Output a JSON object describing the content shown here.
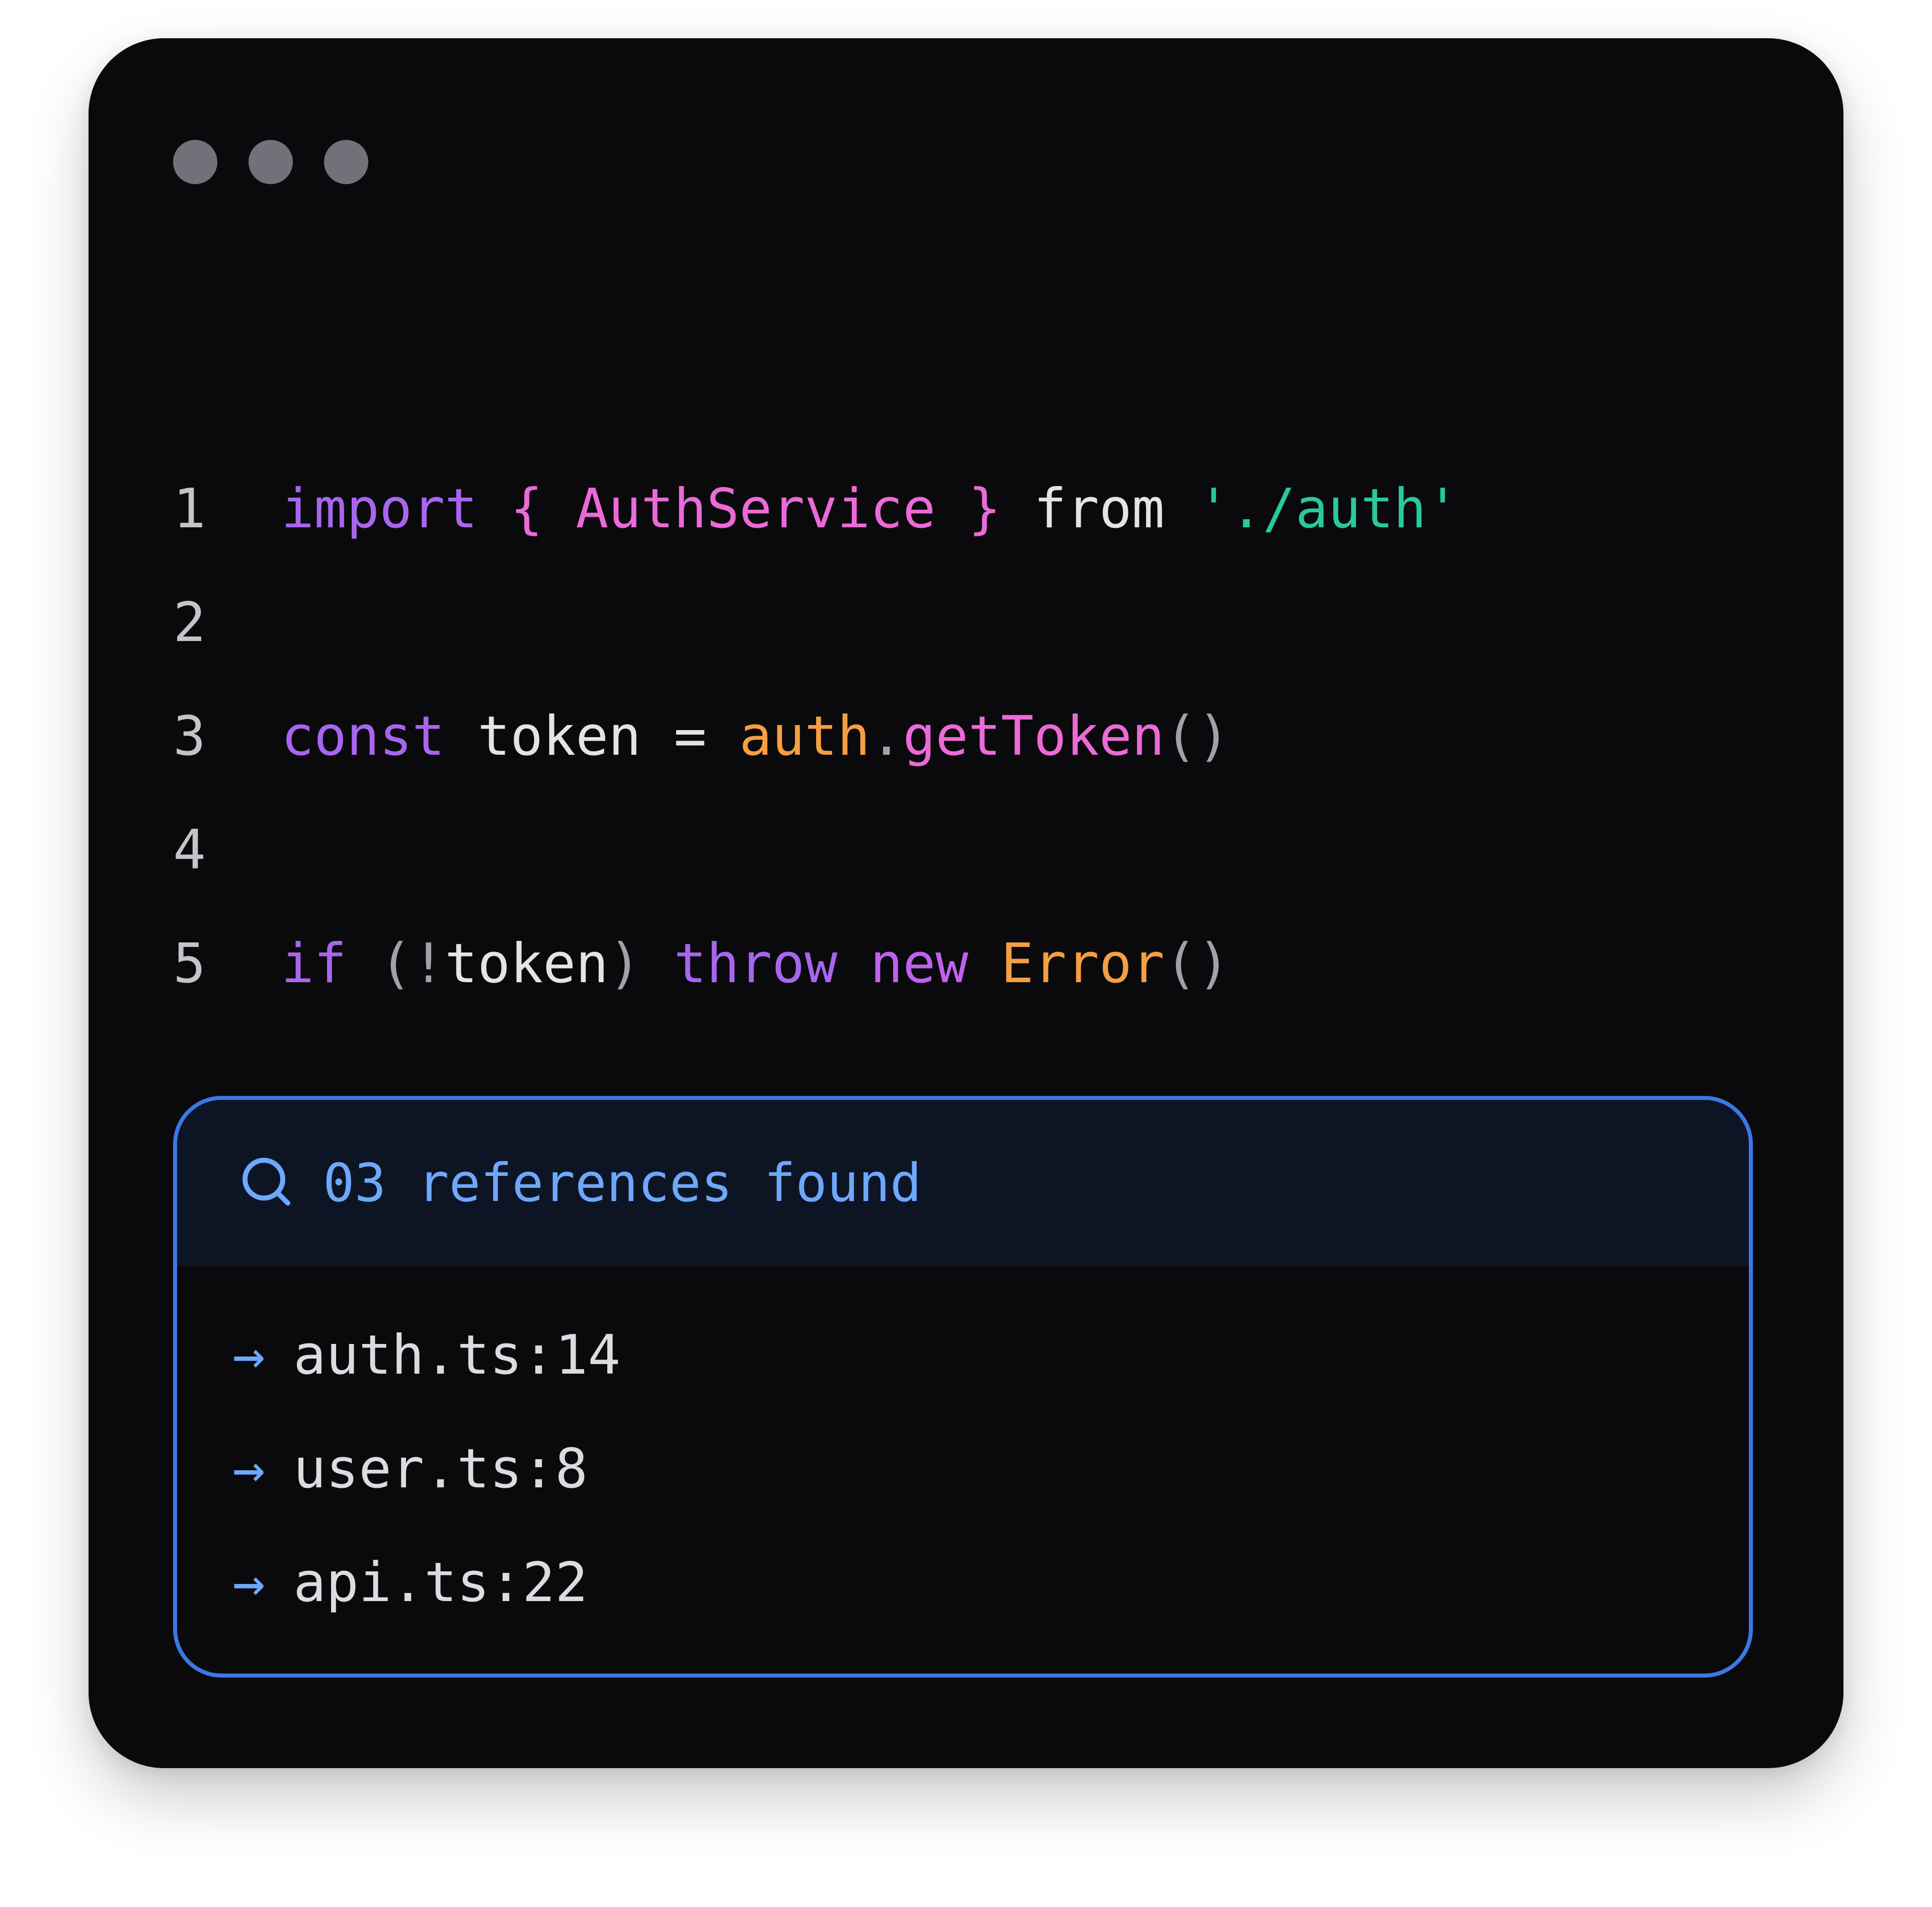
{
  "window": {
    "controls": [
      "dot",
      "dot",
      "dot"
    ]
  },
  "code": {
    "lines": [
      {
        "number": "1",
        "tokens": [
          {
            "text": "import",
            "role": "keyword"
          },
          {
            "text": " ",
            "role": "space"
          },
          {
            "text": "{",
            "role": "punct-pink"
          },
          {
            "text": " ",
            "role": "space"
          },
          {
            "text": "AuthService",
            "role": "ident-pink"
          },
          {
            "text": " ",
            "role": "space"
          },
          {
            "text": "}",
            "role": "punct-pink"
          },
          {
            "text": " ",
            "role": "space"
          },
          {
            "text": "from",
            "role": "plain"
          },
          {
            "text": " ",
            "role": "space"
          },
          {
            "text": "'./auth'",
            "role": "string"
          }
        ]
      },
      {
        "number": "2",
        "tokens": []
      },
      {
        "number": "3",
        "tokens": [
          {
            "text": "const",
            "role": "keyword"
          },
          {
            "text": " ",
            "role": "space"
          },
          {
            "text": "token",
            "role": "plain"
          },
          {
            "text": " = ",
            "role": "plain"
          },
          {
            "text": "auth",
            "role": "orange"
          },
          {
            "text": ".",
            "role": "dim"
          },
          {
            "text": "getToken",
            "role": "ident-pink"
          },
          {
            "text": "()",
            "role": "dim"
          }
        ]
      },
      {
        "number": "4",
        "tokens": []
      },
      {
        "number": "5",
        "tokens": [
          {
            "text": "if",
            "role": "keyword"
          },
          {
            "text": " ",
            "role": "space"
          },
          {
            "text": "(!",
            "role": "dim"
          },
          {
            "text": "token",
            "role": "plain"
          },
          {
            "text": ")",
            "role": "dim"
          },
          {
            "text": " ",
            "role": "space"
          },
          {
            "text": "throw",
            "role": "keyword"
          },
          {
            "text": " ",
            "role": "space"
          },
          {
            "text": "new",
            "role": "keyword2"
          },
          {
            "text": " ",
            "role": "space"
          },
          {
            "text": "Error",
            "role": "orange"
          },
          {
            "text": "()",
            "role": "dim"
          }
        ]
      }
    ]
  },
  "references": {
    "icon": "search-icon",
    "title": "03 references found",
    "items": [
      {
        "arrow": "→",
        "label": "auth.ts:14"
      },
      {
        "arrow": "→",
        "label": "user.ts:8"
      },
      {
        "arrow": "→",
        "label": "api.ts:22"
      }
    ]
  },
  "colors": {
    "window_bg": "#0a0a0c",
    "accent_blue": "#3b78e6",
    "keyword": "#a866ef",
    "pink": "#ec6ad8",
    "string": "#29c99b",
    "orange": "#f59e42"
  }
}
